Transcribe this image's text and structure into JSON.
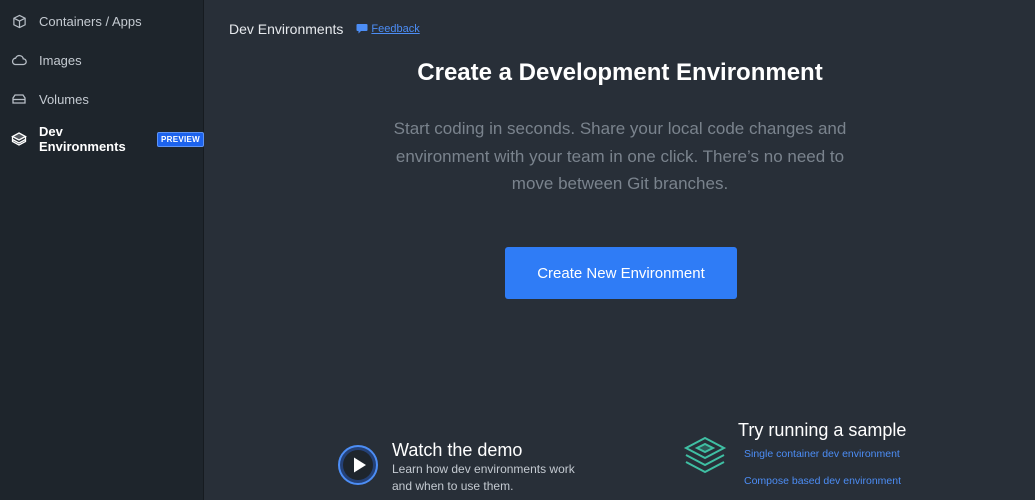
{
  "sidebar": {
    "items": [
      {
        "label": "Containers / Apps",
        "icon": "containers-icon"
      },
      {
        "label": "Images",
        "icon": "cloud-icon"
      },
      {
        "label": "Volumes",
        "icon": "volume-icon"
      },
      {
        "label": "Dev Environments",
        "icon": "dev-environments-icon",
        "badge": "PREVIEW",
        "active": true
      }
    ]
  },
  "header": {
    "title": "Dev Environments",
    "feedback_label": "Feedback"
  },
  "hero": {
    "title": "Create a Development Environment",
    "description": "Start coding in seconds. Share your local code changes and environment with your team in one click. There’s no need to move between Git branches.",
    "create_button": "Create New Environment"
  },
  "demo": {
    "title": "Watch the demo",
    "description": "Learn how dev environments work and when to use them."
  },
  "sample": {
    "title": "Try running a sample",
    "links": [
      "Single container dev environment",
      "Compose based dev environment"
    ]
  },
  "colors": {
    "accent": "#2f7cf6",
    "link": "#4c8df5",
    "sidebar_bg": "#1e252c",
    "main_bg": "#282f38",
    "sample_icon": "#3fbfa3"
  }
}
